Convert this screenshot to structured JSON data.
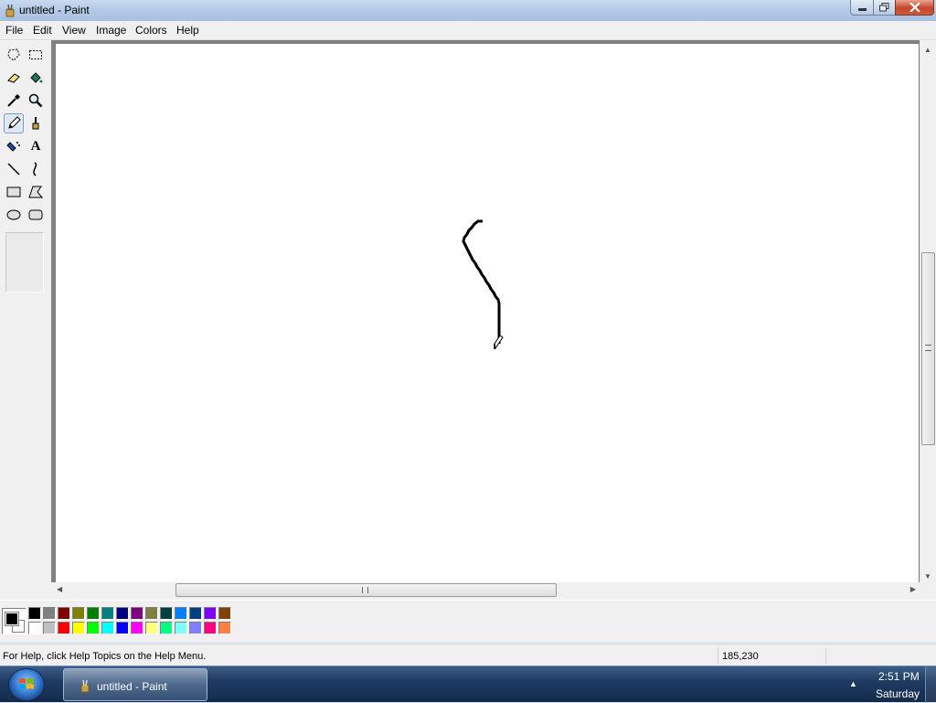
{
  "window": {
    "title": "untitled - Paint",
    "icon": "paint-brush-cup-icon"
  },
  "menu": {
    "items": [
      "File",
      "Edit",
      "View",
      "Image",
      "Colors",
      "Help"
    ]
  },
  "toolbox": {
    "tools": [
      {
        "name": "free-form-select-icon"
      },
      {
        "name": "rect-select-icon"
      },
      {
        "name": "eraser-icon"
      },
      {
        "name": "fill-bucket-icon"
      },
      {
        "name": "color-picker-icon"
      },
      {
        "name": "magnifier-icon"
      },
      {
        "name": "pencil-icon",
        "active": true
      },
      {
        "name": "brush-icon"
      },
      {
        "name": "airbrush-icon"
      },
      {
        "name": "text-icon"
      },
      {
        "name": "line-icon"
      },
      {
        "name": "curve-icon"
      },
      {
        "name": "rectangle-icon"
      },
      {
        "name": "polygon-icon"
      },
      {
        "name": "ellipse-icon"
      },
      {
        "name": "rounded-rectangle-icon"
      }
    ]
  },
  "colors": {
    "foreground": "#000000",
    "background": "#ffffff",
    "palette_row1": [
      "#000000",
      "#808080",
      "#800000",
      "#808000",
      "#008000",
      "#008080",
      "#000080",
      "#800080",
      "#808040",
      "#004040",
      "#0080ff",
      "#004080",
      "#8000ff",
      "#804000"
    ],
    "palette_row2": [
      "#ffffff",
      "#c0c0c0",
      "#ff0000",
      "#ffff00",
      "#00ff00",
      "#00ffff",
      "#0000ff",
      "#ff00ff",
      "#ffff80",
      "#00ff80",
      "#80ffff",
      "#8080ff",
      "#ff0080",
      "#ff8040"
    ]
  },
  "statusbar": {
    "help_text": "For Help, click Help Topics on the Help Menu.",
    "coordinates": "185,230"
  },
  "taskbar": {
    "start": "windows-start-orb-icon",
    "active_task": "untitled - Paint",
    "clock_time": "2:51 PM",
    "clock_day": "Saturday"
  }
}
